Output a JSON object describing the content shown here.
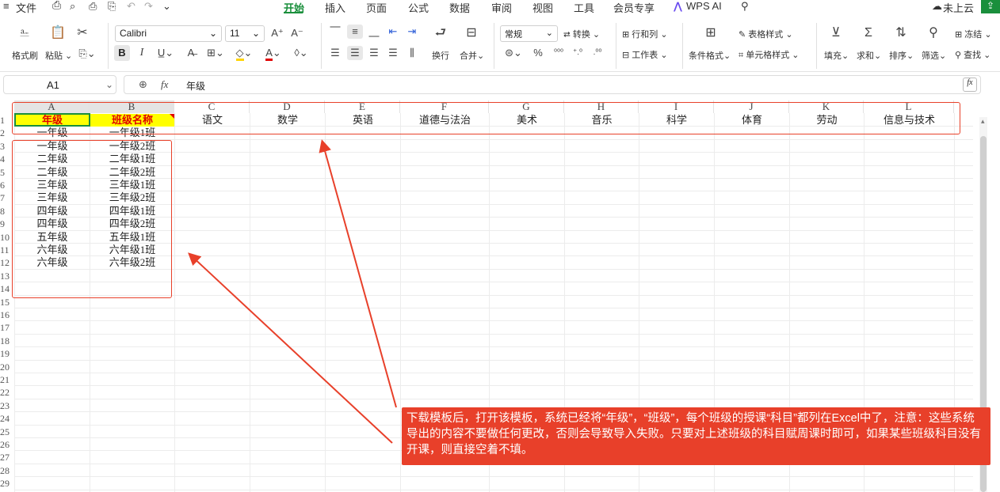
{
  "menubar": {
    "file": "文件",
    "tabs": [
      "开始",
      "插入",
      "页面",
      "公式",
      "数据",
      "审阅",
      "视图",
      "工具",
      "会员专享"
    ],
    "wps_ai": "WPS AI",
    "cloud": "未上云"
  },
  "ribbon": {
    "format_painter": "格式刷",
    "paste": "粘贴",
    "font_name": "Calibri",
    "font_size": "11",
    "wrap": "换行",
    "merge": "合并",
    "convert": "转换",
    "number_format": "常规",
    "rows_cols": "行和列",
    "worksheet": "工作表",
    "cond_format": "条件格式",
    "table_style": "表格样式",
    "cell_style": "单元格样式",
    "fill": "填充",
    "sum": "求和",
    "sort": "排序",
    "filter": "筛选",
    "freeze": "冻结",
    "find": "查找"
  },
  "formula_bar": {
    "cell_ref": "A1",
    "fx": "fx",
    "content": "年级"
  },
  "columns": [
    "A",
    "B",
    "C",
    "D",
    "E",
    "F",
    "G",
    "H",
    "I",
    "J",
    "K",
    "L"
  ],
  "rows": [
    "1",
    "2",
    "3",
    "4",
    "5",
    "6",
    "7",
    "8",
    "9",
    "10",
    "11",
    "12",
    "13",
    "14",
    "15",
    "16",
    "17",
    "18",
    "19",
    "20",
    "21",
    "22",
    "23",
    "24",
    "25",
    "26",
    "27",
    "28",
    "29"
  ],
  "header_row": [
    "年级",
    "班级名称",
    "语文",
    "数学",
    "英语",
    "道德与法治",
    "美术",
    "音乐",
    "科学",
    "体育",
    "劳动",
    "信息与技术"
  ],
  "data_rows": [
    [
      "一年级",
      "一年级1班"
    ],
    [
      "一年级",
      "一年级2班"
    ],
    [
      "二年级",
      "二年级1班"
    ],
    [
      "二年级",
      "二年级2班"
    ],
    [
      "三年级",
      "三年级1班"
    ],
    [
      "三年级",
      "三年级2班"
    ],
    [
      "四年级",
      "四年级1班"
    ],
    [
      "四年级",
      "四年级2班"
    ],
    [
      "五年级",
      "五年级1班"
    ],
    [
      "六年级",
      "六年级1班"
    ],
    [
      "六年级",
      "六年级2班"
    ]
  ],
  "callout_text": "下载模板后，打开该模板，系统已经将“年级”，“班级”，每个班级的授课“科目”都列在Excel中了，注意：这些系统导出的内容不要做任何更改，否则会导致导入失败。只要对上述班级的科目赋周课时即可，如果某些班级科目没有开课，则直接空着不填。",
  "colors": {
    "accent_green": "#1a8f3c",
    "annotation_red": "#e8402a",
    "header_yellow": "#ffff00",
    "header_text_red": "#e00000"
  }
}
